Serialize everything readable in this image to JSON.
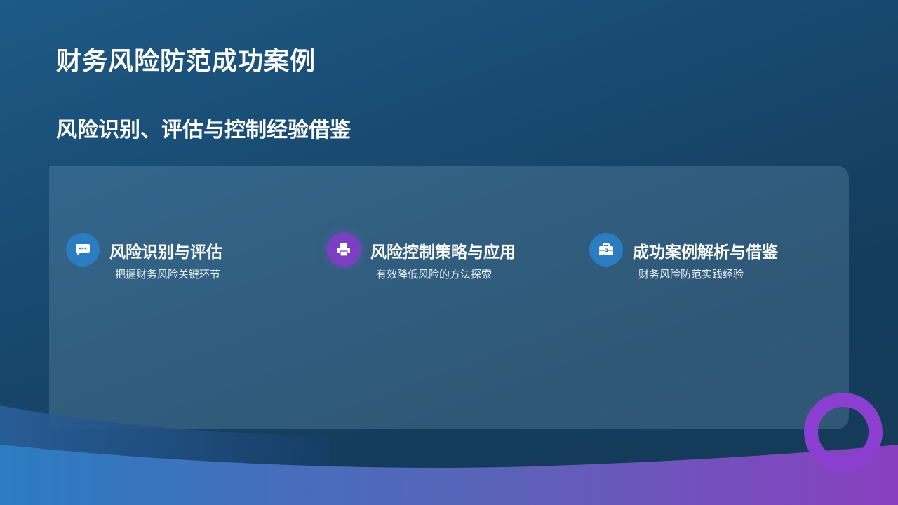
{
  "slide": {
    "title": "财务风险防范成功案例",
    "subtitle": "风险识别、评估与控制经验借鉴"
  },
  "items": [
    {
      "icon": "chat-bubble-icon",
      "color": "#2b7cc1",
      "heading": "风险识别与评估",
      "desc": "把握财务风险关键环节"
    },
    {
      "icon": "printer-icon",
      "color": "#7b3fc4",
      "heading": "风险控制策略与应用",
      "desc": "有效降低风险的方法探索"
    },
    {
      "icon": "briefcase-icon",
      "color": "#2b7cc1",
      "heading": "成功案例解析与借鉴",
      "desc": "财务风险防范实践经验"
    }
  ],
  "colors": {
    "accent_blue": "#2b7cc1",
    "accent_purple": "#7b3fc4",
    "ring": "#8a3fd0"
  }
}
